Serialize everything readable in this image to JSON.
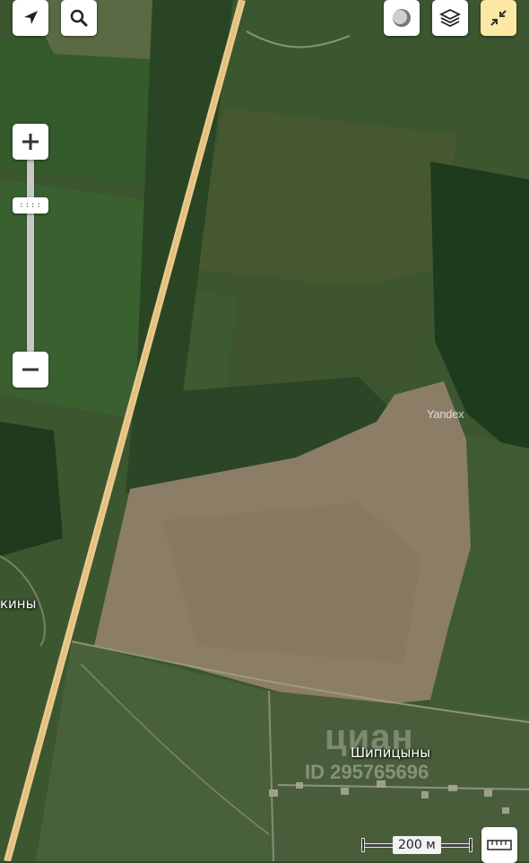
{
  "map": {
    "labels": {
      "left_settlement": "кины",
      "shipitsyny": "Шипицыны"
    },
    "provider_mark": "Yandex",
    "watermark": {
      "brand": "циан",
      "id": "ID 295765696"
    },
    "scale": {
      "label": "200 м"
    }
  },
  "controls": {
    "locate": "arrow-navigation-icon",
    "search": "magnifier-icon",
    "traffic": "traffic-circle-icon",
    "layers": "layers-icon",
    "collapse": "collapse-arrows-icon",
    "zoom_in": "+",
    "zoom_out": "−",
    "zoom_handle": "::::",
    "ruler": "ruler-icon"
  },
  "colors": {
    "road": "#e9c98a",
    "field_bare": "#8f8068",
    "field_green": "#3f5a30",
    "forest": "#1f3a1c",
    "collapse_button": "#fde9a3"
  }
}
